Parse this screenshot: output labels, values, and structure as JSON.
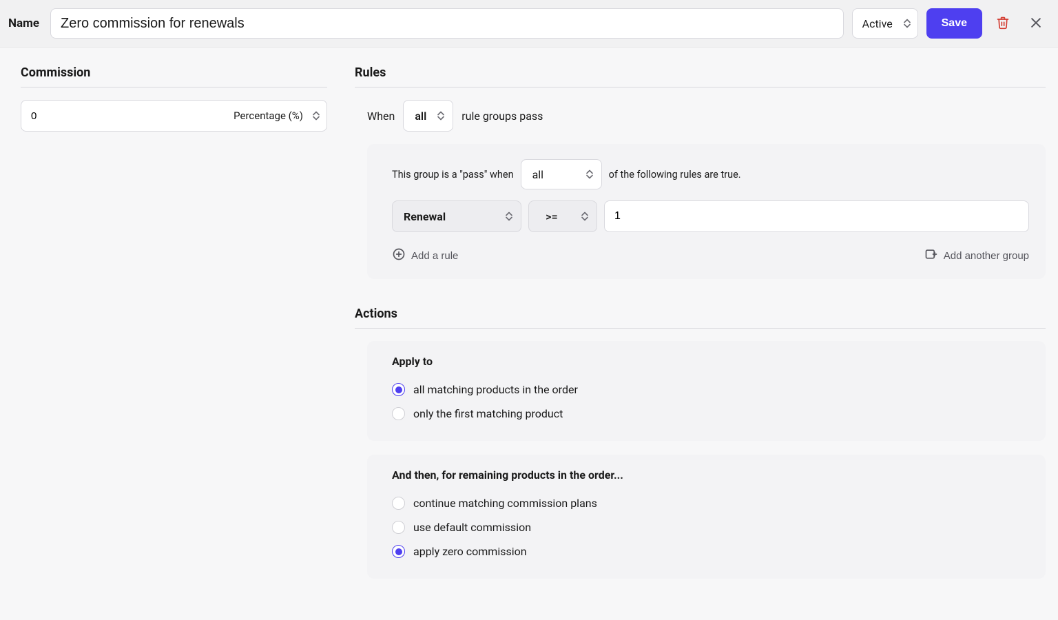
{
  "header": {
    "name_label": "Name",
    "name_value": "Zero commission for renewals",
    "status": "Active",
    "save_label": "Save"
  },
  "commission": {
    "title": "Commission",
    "value": "0",
    "unit": "Percentage (%)"
  },
  "rules": {
    "title": "Rules",
    "when_prefix": "When",
    "when_mode": "all",
    "when_suffix": "rule groups pass",
    "group": {
      "prefix": "This group is a \"pass\" when",
      "mode": "all",
      "suffix": "of the following rules are true.",
      "rule": {
        "attribute": "Renewal",
        "operator": ">=",
        "value": "1"
      },
      "add_rule_label": "Add a rule",
      "add_group_label": "Add another group"
    }
  },
  "actions": {
    "title": "Actions",
    "apply_to": {
      "heading": "Apply to",
      "options": [
        "all matching products in the order",
        "only the first matching product"
      ],
      "selected_index": 0
    },
    "remaining": {
      "heading": "And then, for remaining products in the order...",
      "options": [
        "continue matching commission plans",
        "use default commission",
        "apply zero commission"
      ],
      "selected_index": 2
    }
  }
}
